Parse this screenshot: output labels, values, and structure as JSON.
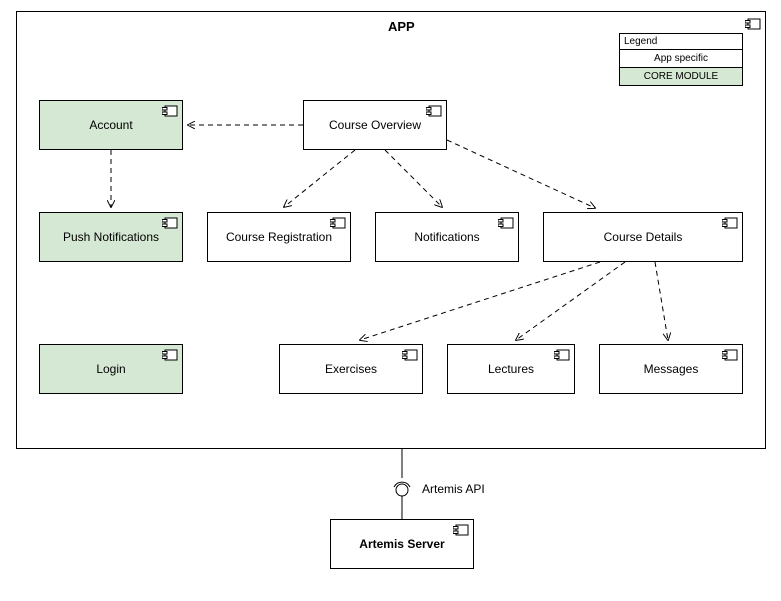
{
  "title": "APP",
  "legend": {
    "title": "Legend",
    "appSpecific": "App specific",
    "coreModule": "CORE MODULE"
  },
  "components": {
    "account": "Account",
    "pushNotifications": "Push Notifications",
    "login": "Login",
    "courseOverview": "Course Overview",
    "courseRegistration": "Course Registration",
    "notifications": "Notifications",
    "courseDetails": "Course Details",
    "exercises": "Exercises",
    "lectures": "Lectures",
    "messages": "Messages",
    "artemisServer": "Artemis Server"
  },
  "api": "Artemis API"
}
